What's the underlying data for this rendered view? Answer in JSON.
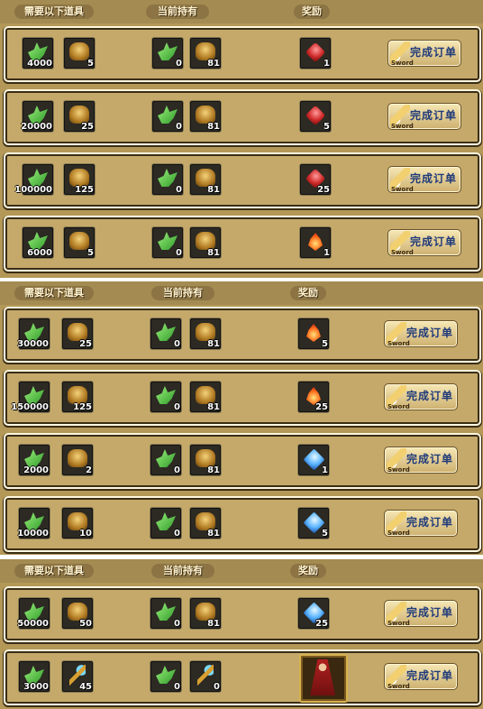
{
  "headers": {
    "need": "需要以下道具",
    "have": "当前持有",
    "reward": "奖励"
  },
  "button": {
    "label": "完成订单",
    "sub": "Sword"
  },
  "sections": [
    {
      "rows": [
        {
          "need1": "4000",
          "need2": "5",
          "have1": "0",
          "have2": "81",
          "reward_icon": "ruby-icon",
          "reward": "1"
        },
        {
          "need1": "20000",
          "need2": "25",
          "have1": "0",
          "have2": "81",
          "reward_icon": "ruby-icon",
          "reward": "5"
        },
        {
          "need1": "100000",
          "need2": "125",
          "have1": "0",
          "have2": "81",
          "reward_icon": "ruby-icon",
          "reward": "25"
        },
        {
          "need1": "6000",
          "need2": "5",
          "have1": "0",
          "have2": "81",
          "reward_icon": "fire-gem-icon",
          "reward": "1"
        }
      ]
    },
    {
      "rows": [
        {
          "need1": "30000",
          "need2": "25",
          "have1": "0",
          "have2": "81",
          "reward_icon": "fire-gem-icon",
          "reward": "5"
        },
        {
          "need1": "150000",
          "need2": "125",
          "have1": "0",
          "have2": "81",
          "reward_icon": "fire-gem-icon",
          "reward": "25"
        },
        {
          "need1": "2000",
          "need2": "2",
          "have1": "0",
          "have2": "81",
          "reward_icon": "ice-gem-icon",
          "reward": "1"
        },
        {
          "need1": "10000",
          "need2": "10",
          "have1": "0",
          "have2": "81",
          "reward_icon": "ice-gem-icon",
          "reward": "5"
        }
      ]
    },
    {
      "rows": [
        {
          "need1": "50000",
          "need2": "50",
          "have1": "0",
          "have2": "81",
          "reward_icon": "ice-gem-icon",
          "reward": "25"
        },
        {
          "need1": "3000",
          "need2": "45",
          "have1": "0",
          "have2": "0",
          "reward_icon": "hero-portrait",
          "reward": ""
        }
      ]
    }
  ]
}
